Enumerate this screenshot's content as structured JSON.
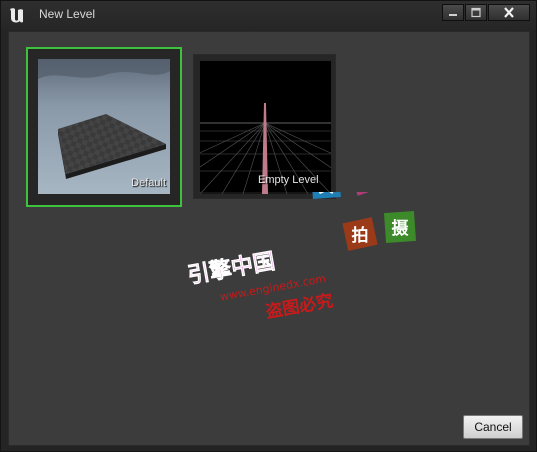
{
  "window": {
    "title": "New Level",
    "logo_icon": "unreal-engine-logo-icon",
    "controls": {
      "minimize_icon": "minimize-icon",
      "maximize_icon": "maximize-icon",
      "close_icon": "close-icon"
    }
  },
  "templates": [
    {
      "label": "Default",
      "selected": true
    },
    {
      "label": "Empty Level",
      "selected": false
    }
  ],
  "watermark": {
    "line1": "引擎中国",
    "url": "www.enginedx.com",
    "line3": "盗图必究",
    "badges": [
      "实",
      "物",
      "拍",
      "摄"
    ]
  },
  "footer": {
    "cancel_label": "Cancel"
  },
  "colors": {
    "selection_border": "#3cc23c",
    "panel_bg": "#3c3c3c",
    "titlebar_bg": "#2a2a2a"
  }
}
